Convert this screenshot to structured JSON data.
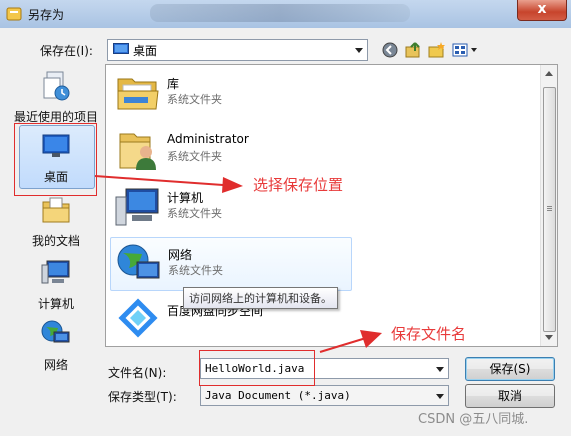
{
  "window": {
    "title": "另存为",
    "close_label": "x"
  },
  "location": {
    "label": "保存在(I):",
    "value": "桌面"
  },
  "toolbar_icons": [
    "back-icon",
    "up-folder-icon",
    "new-folder-icon",
    "view-menu-icon"
  ],
  "places": [
    {
      "label": "最近使用的项目",
      "icon": "recent-items-icon"
    },
    {
      "label": "桌面",
      "icon": "desktop-icon",
      "selected": true
    },
    {
      "label": "我的文档",
      "icon": "documents-icon"
    },
    {
      "label": "计算机",
      "icon": "computer-icon"
    },
    {
      "label": "网络",
      "icon": "network-icon"
    }
  ],
  "files": [
    {
      "name": "库",
      "type": "系统文件夹",
      "icon": "library-icon"
    },
    {
      "name": "Administrator",
      "type": "系统文件夹",
      "icon": "user-folder-icon"
    },
    {
      "name": "计算机",
      "type": "系统文件夹",
      "icon": "computer-icon"
    },
    {
      "name": "网络",
      "type": "系统文件夹",
      "icon": "network-icon"
    },
    {
      "name": "百度网盘同步空间",
      "type": "",
      "icon": "baidu-netdisk-icon"
    }
  ],
  "tooltip": "访问网络上的计算机和设备。",
  "filename": {
    "label": "文件名(N):",
    "value": "HelloWorld.java"
  },
  "filetype": {
    "label": "保存类型(T):",
    "value": "Java Document (*.java)"
  },
  "buttons": {
    "save": "保存(S)",
    "cancel": "取消"
  },
  "annotations": {
    "location": "选择保存位置",
    "filename": "保存文件名"
  },
  "watermark": "CSDN @五八同城.",
  "colors": {
    "annotation_red": "#e02d2d",
    "selection_blue": "#c1dbfc"
  }
}
